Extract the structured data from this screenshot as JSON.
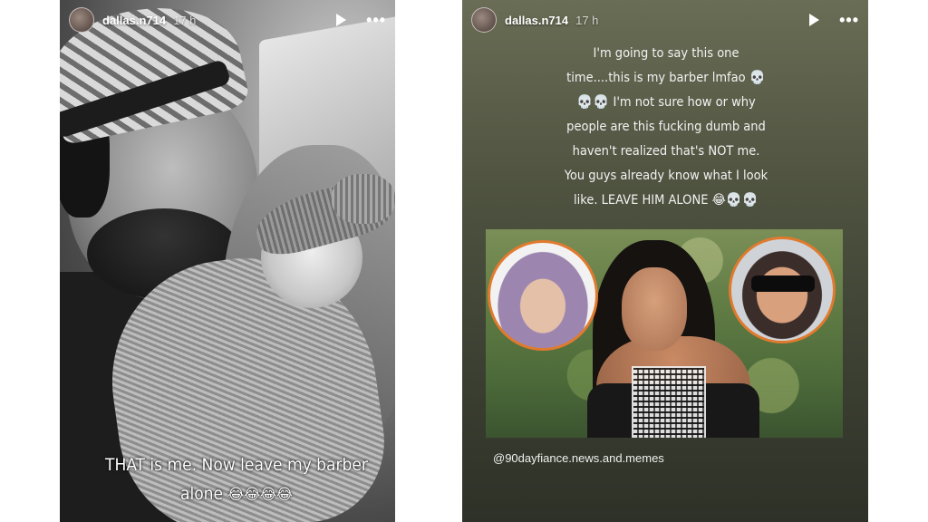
{
  "left_story": {
    "username": "dallas.n714",
    "time": "17 h",
    "caption": {
      "line1": "THAT is me. Now leave my barber",
      "line2": "alone",
      "emojis": "😂😂😂😂"
    }
  },
  "right_story": {
    "username": "dallas.n714",
    "time": "17 h",
    "text_lines": [
      "I'm going to say this one",
      "time....this is my barber lmfao 💀",
      "💀💀 I'm not sure how or why",
      "people are this fucking dumb and",
      "haven't realized that's NOT me.",
      "You guys already know what I look",
      "like. LEAVE HIM ALONE 😂💀💀"
    ],
    "mention": "@90dayfiance.news.and.memes"
  },
  "icons": {
    "play": "play-icon",
    "more": "more-options-icon",
    "avatar": "avatar"
  },
  "colors": {
    "accent_circle_border": "#e07a2e"
  }
}
